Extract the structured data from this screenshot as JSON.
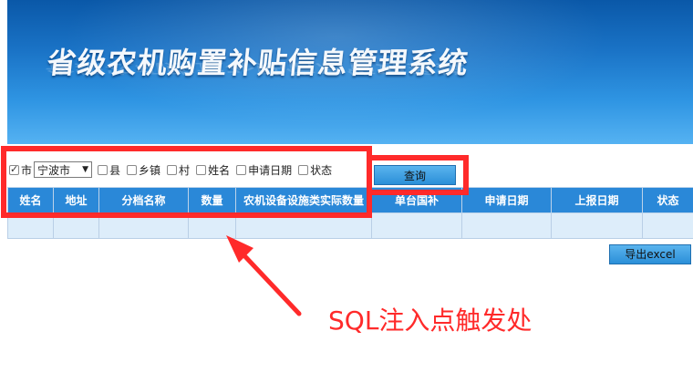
{
  "banner": {
    "title": "省级农机购置补贴信息管理系统"
  },
  "filters": {
    "city": {
      "label": "市",
      "checked": true,
      "selected": "宁波市"
    },
    "county": {
      "label": "县",
      "checked": false
    },
    "town": {
      "label": "乡镇",
      "checked": false
    },
    "village": {
      "label": "村",
      "checked": false
    },
    "name": {
      "label": "姓名",
      "checked": false
    },
    "apply_date": {
      "label": "申请日期",
      "checked": false
    },
    "status": {
      "label": "状态",
      "checked": false
    }
  },
  "query_button": "查询",
  "table": {
    "headers": [
      "姓名",
      "地址",
      "分档名称",
      "数量",
      "农机设备设施类实际数量",
      "单台国补",
      "申请日期",
      "上报日期",
      "状态"
    ]
  },
  "export_button": "导出excel",
  "annotation": {
    "text": "SQL注入点触发处",
    "color": "#ff2a2a"
  },
  "colors": {
    "header_bg": "#2a88d8",
    "row_bg": "#ddedfa",
    "banner_accent": "#1a73c6"
  }
}
